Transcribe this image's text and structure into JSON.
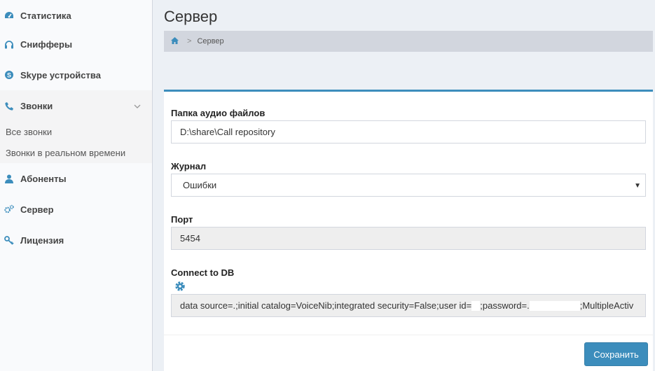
{
  "sidebar": {
    "items": [
      {
        "label": "Статистика",
        "icon": "dashboard-icon"
      },
      {
        "label": "Снифферы",
        "icon": "headphones-icon"
      },
      {
        "label": "Skype устройства",
        "icon": "skype-icon"
      },
      {
        "label": "Звонки",
        "icon": "phone-icon"
      },
      {
        "label": "Абоненты",
        "icon": "user-icon"
      },
      {
        "label": "Сервер",
        "icon": "gears-icon"
      },
      {
        "label": "Лицензия",
        "icon": "key-icon"
      }
    ],
    "subitems": [
      {
        "label": "Все звонки"
      },
      {
        "label": "Звонки в реальном времени"
      }
    ]
  },
  "page": {
    "title": "Сервер",
    "breadcrumb": {
      "home_icon": "home-icon",
      "current": "Сервер"
    }
  },
  "form": {
    "audio_folder": {
      "label": "Папка аудио файлов",
      "value": "D:\\share\\Call repository"
    },
    "journal": {
      "label": "Журнал",
      "value": "Ошибки"
    },
    "port": {
      "label": "Порт",
      "value": "5454"
    },
    "db": {
      "label": "Connect to DB",
      "value_part1": "data source=.;initial catalog=VoiceNib;integrated security=False;user id=",
      "value_part2": ";password=.",
      "value_part3": ";MultipleActiv"
    },
    "save_label": "Сохранить"
  },
  "colors": {
    "accent": "#3c8dbc",
    "sidebar_bg": "#f9fafc",
    "content_bg": "#ecf0f5"
  }
}
